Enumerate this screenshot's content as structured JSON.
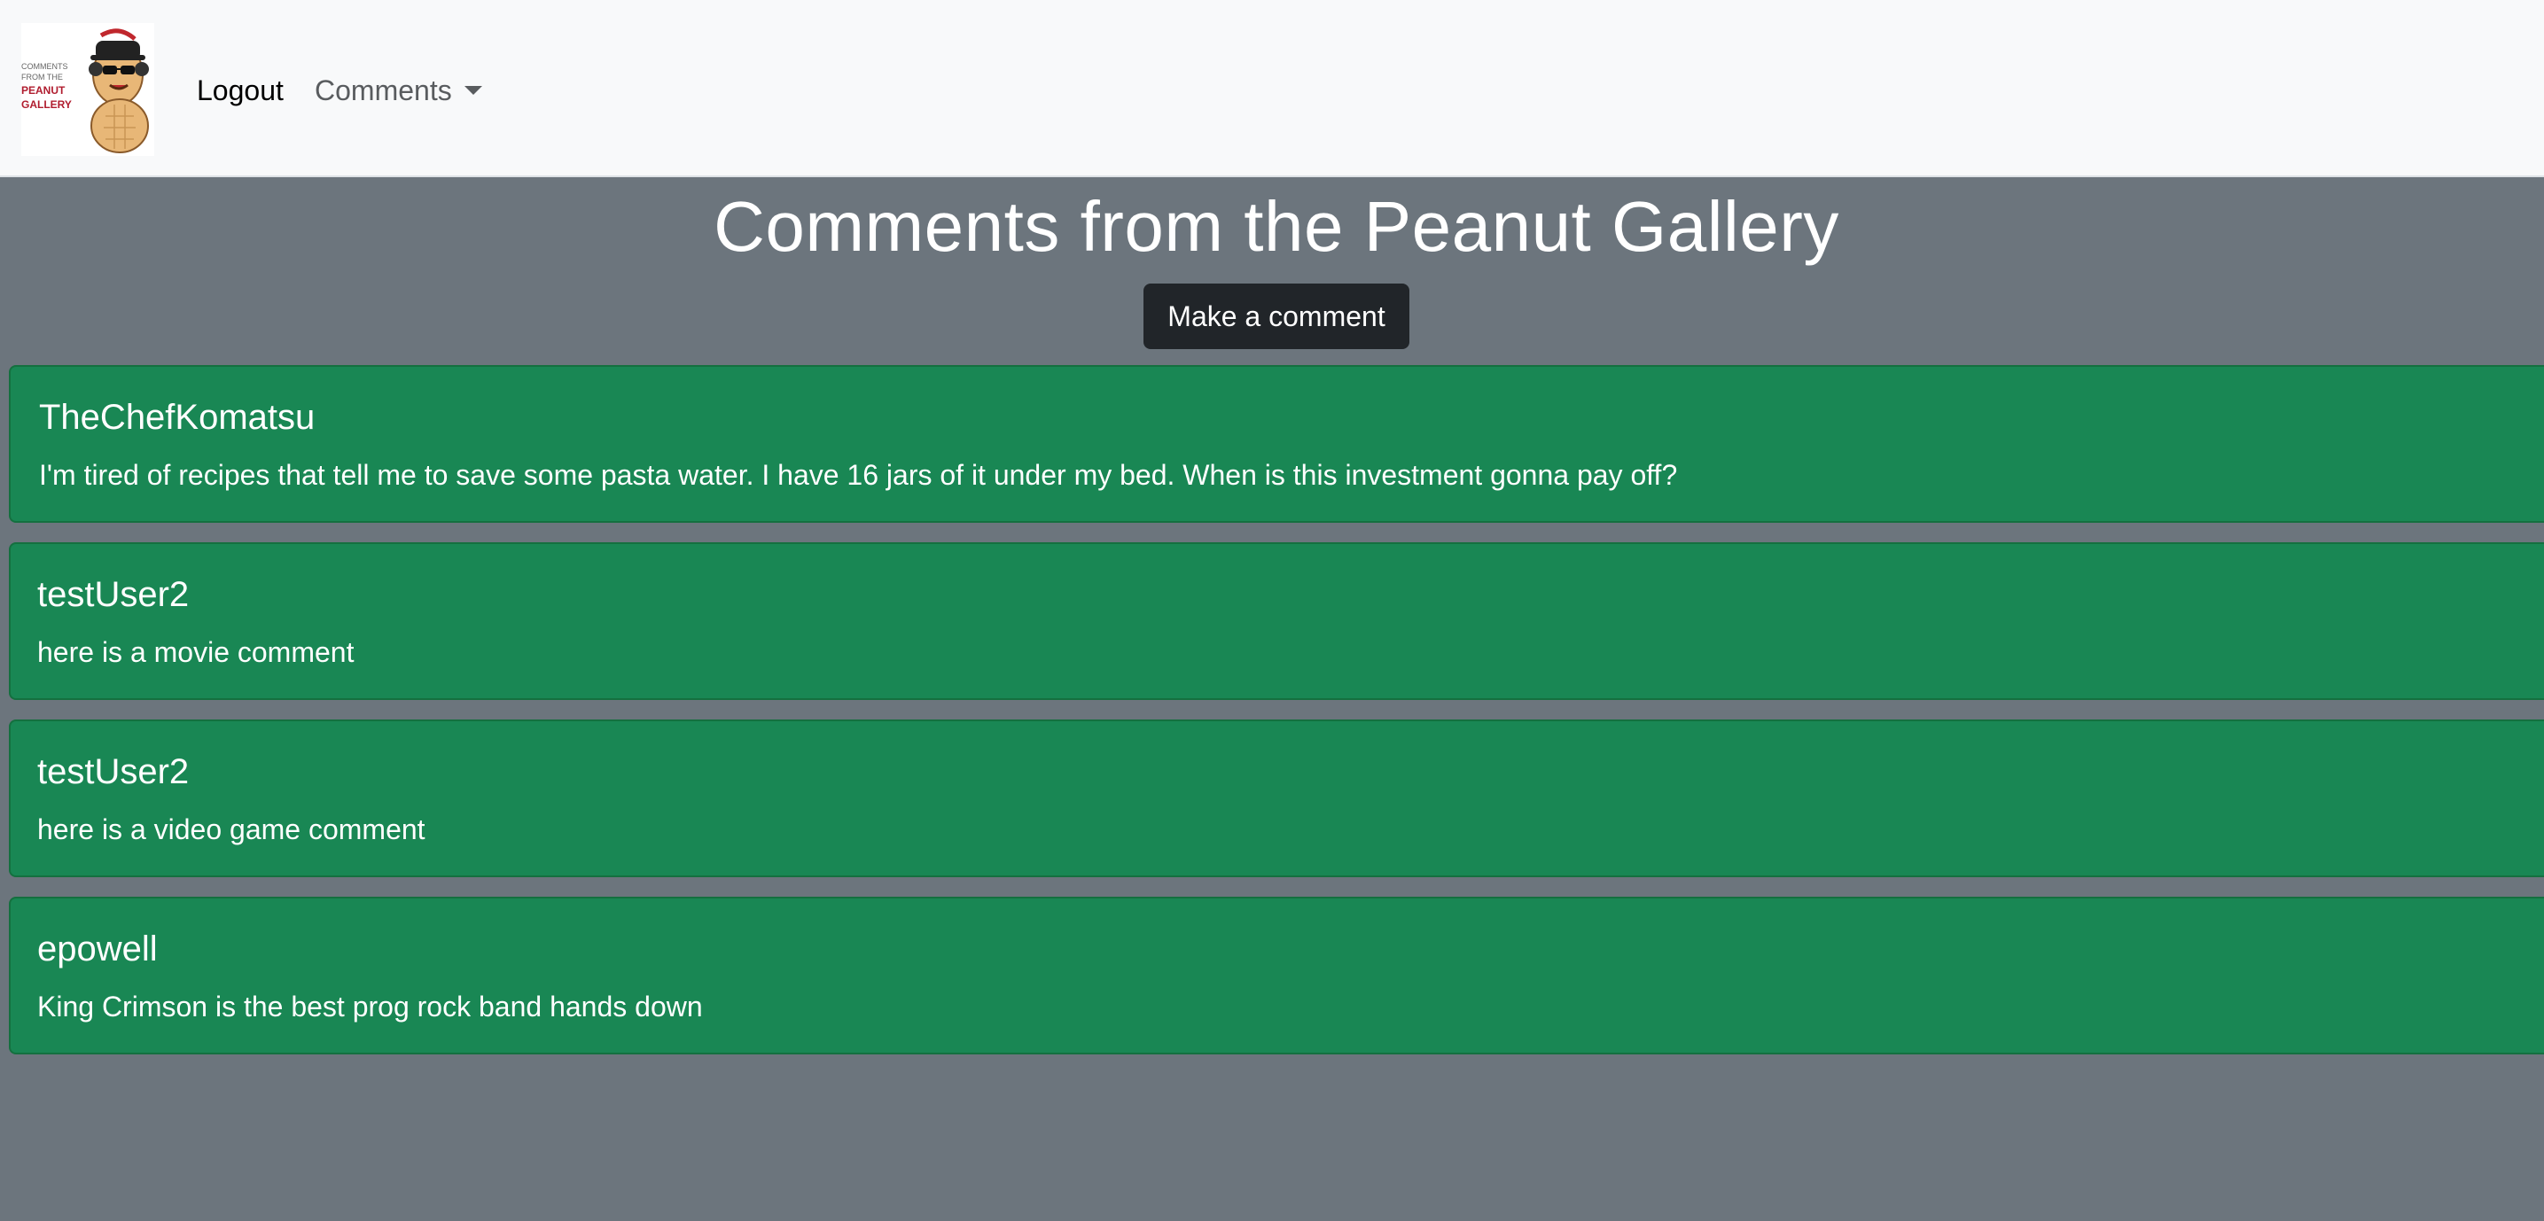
{
  "nav": {
    "logo_text": {
      "line1": "COMMENTS",
      "line2": "FROM THE",
      "line3": "PEANUT",
      "line4": "GALLERY"
    },
    "logout_label": "Logout",
    "comments_label": "Comments"
  },
  "main": {
    "title": "Comments from the Peanut Gallery",
    "make_comment_label": "Make a comment"
  },
  "comments": [
    {
      "user": "TheChefKomatsu",
      "text": "I'm tired of recipes that tell me to save some pasta water. I have 16 jars of it under my bed. When is this investment gonna pay off?"
    },
    {
      "user": "testUser2",
      "text": "here is a movie comment"
    },
    {
      "user": "testUser2",
      "text": "here is a video game comment"
    },
    {
      "user": "epowell",
      "text": "King Crimson is the best prog rock band hands down"
    }
  ],
  "colors": {
    "navbar_bg": "#f8f9fa",
    "page_bg": "#6c757d",
    "card_bg": "#198754",
    "button_bg": "#212529"
  },
  "icons": {
    "logo": "peanut-mascot-logo",
    "dropdown": "caret-down-icon"
  }
}
